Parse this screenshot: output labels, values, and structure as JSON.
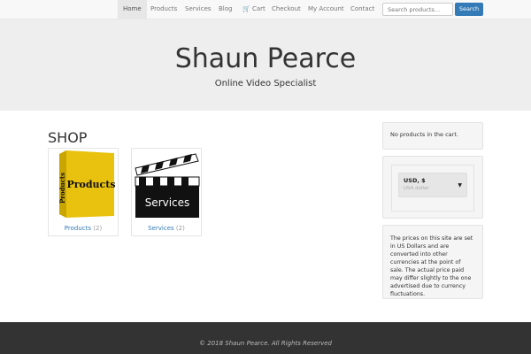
{
  "nav": {
    "items": [
      {
        "label": "Home"
      },
      {
        "label": "Products"
      },
      {
        "label": "Services"
      },
      {
        "label": "Blog"
      },
      {
        "label": "Cart"
      },
      {
        "label": "Checkout"
      },
      {
        "label": "My Account"
      },
      {
        "label": "Contact"
      }
    ],
    "search_placeholder": "Search products…",
    "search_button": "Search"
  },
  "hero": {
    "title": "Shaun Pearce",
    "subtitle": "Online Video Specialist"
  },
  "shop": {
    "heading": "SHOP",
    "categories": [
      {
        "name": "Products",
        "count": "(2)",
        "image_text": "Products"
      },
      {
        "name": "Services",
        "count": "(2)",
        "image_text": "Services"
      }
    ]
  },
  "sidebar": {
    "cart_text": "No products in the cart.",
    "currency": {
      "code": "USD, $",
      "name": "USA dollar"
    },
    "notice": "The prices on this site are set in US Dollars and are converted into other currencies at the point of sale. The actual price paid may differ slightly to the one advertised due to currency fluctuations."
  },
  "footer": {
    "text": "© 2018 Shaun Pearce. All Rights Reserved"
  }
}
